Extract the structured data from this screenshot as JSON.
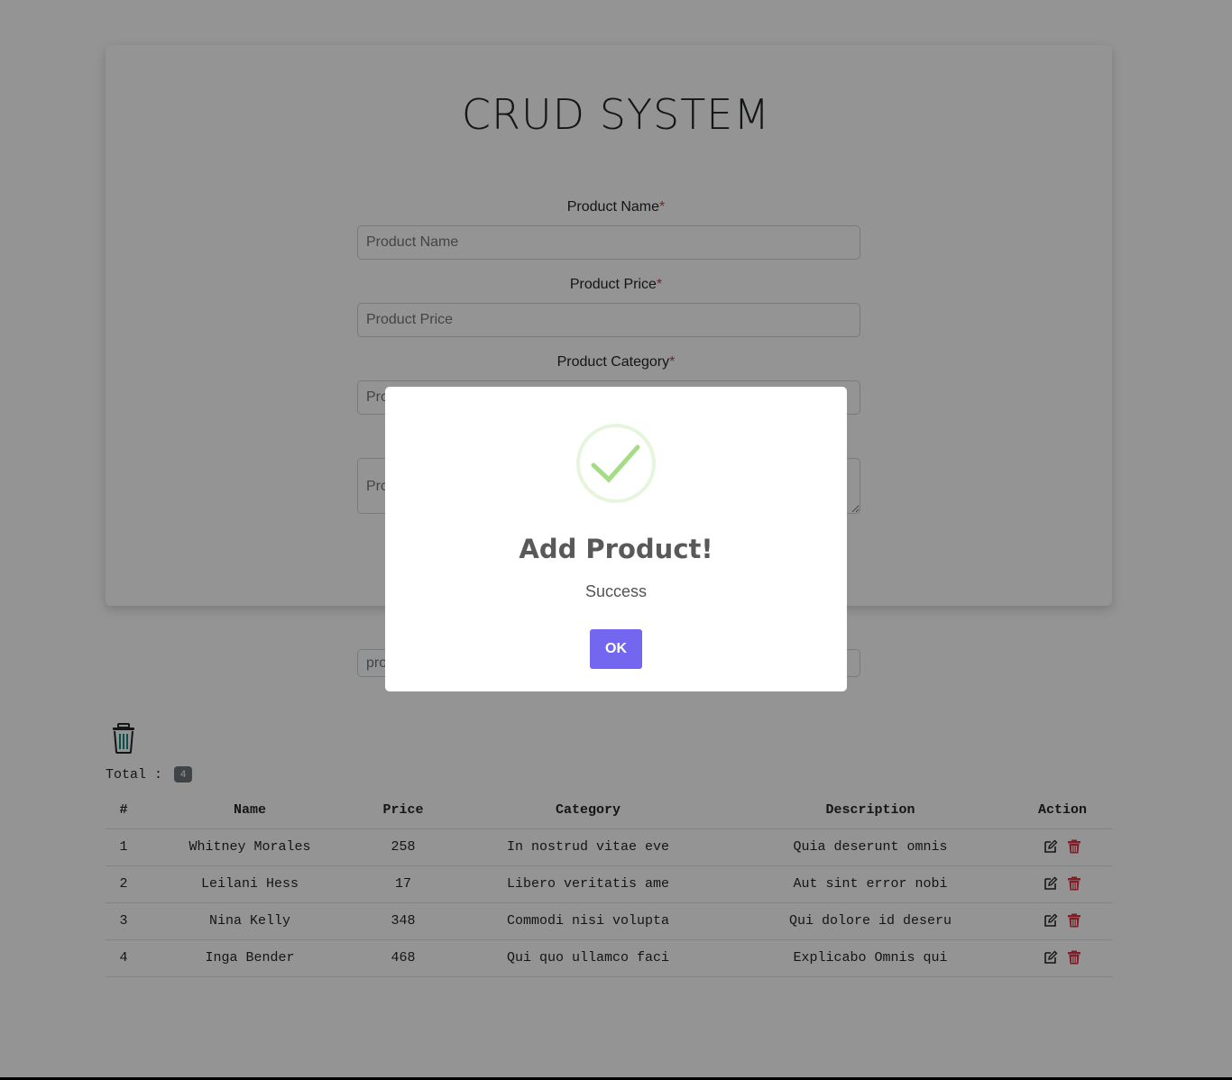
{
  "app": {
    "title": "CRUD SYSTEM"
  },
  "form": {
    "name_label": "Product Name",
    "name_placeholder": "Product Name",
    "price_label": "Product Price",
    "price_placeholder": "Product Price",
    "category_label": "Product Category",
    "category_placeholder": "Pro",
    "description_placeholder": "Pro",
    "required_mark": "*"
  },
  "search": {
    "value": "pro"
  },
  "summary": {
    "total_label": "Total :",
    "total_count": "4"
  },
  "table": {
    "headers": [
      "#",
      "Name",
      "Price",
      "Category",
      "Description",
      "Action"
    ],
    "rows": [
      {
        "num": "1",
        "name": "Whitney Morales",
        "price": "258",
        "category": "In nostrud vitae eve",
        "description": "Quia deserunt omnis"
      },
      {
        "num": "2",
        "name": "Leilani Hess",
        "price": "17",
        "category": "Libero veritatis ame",
        "description": "Aut sint error nobi"
      },
      {
        "num": "3",
        "name": "Nina Kelly",
        "price": "348",
        "category": "Commodi nisi volupta",
        "description": "Qui dolore id deseru"
      },
      {
        "num": "4",
        "name": "Inga Bender",
        "price": "468",
        "category": "Qui quo ullamco faci",
        "description": "Explicabo Omnis qui"
      }
    ]
  },
  "dialog": {
    "title": "Add Product!",
    "text": "Success",
    "ok_label": "OK"
  },
  "icons": {
    "trash_all": "trash-icon",
    "edit": "edit-icon",
    "delete": "delete-icon",
    "success": "success-check-icon"
  },
  "colors": {
    "primary": "#7367f0",
    "danger": "#dc3545",
    "success": "#a5dc86",
    "teal": "#0f8a82"
  }
}
